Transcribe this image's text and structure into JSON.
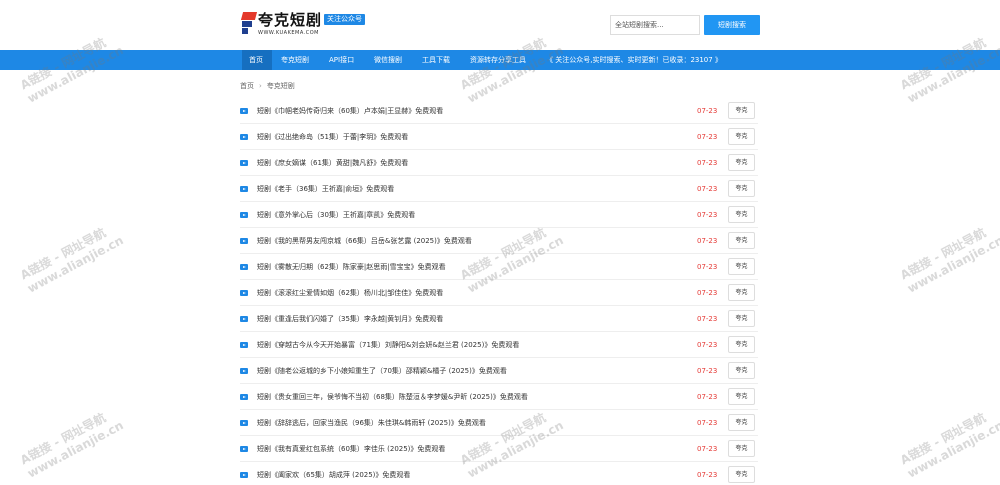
{
  "header": {
    "logo_title": "夸克短剧",
    "logo_sub": "WWW.KUAKEMA.COM",
    "follow_badge": "关注公众号",
    "search_placeholder": "全站短剧搜索...",
    "search_button": "短剧搜索"
  },
  "nav": {
    "items": [
      "首页",
      "夸克短剧",
      "API接口",
      "微信搜剧",
      "工具下载",
      "资源转存分享工具",
      "《 关注公众号,实时搜索、实时更新！已收录：23107 》"
    ],
    "active_index": 0
  },
  "breadcrumb": {
    "home": "首页",
    "separator": "›",
    "current": "夸克短剧"
  },
  "list": {
    "items": [
      {
        "title": "短剧《巾帼老妈传奇归来（60集）卢本娟|王显赫》免费观看",
        "date": "07-23",
        "action": "夸克"
      },
      {
        "title": "短剧《过出绝命岛（51集）于蕾|李玥》免费观看",
        "date": "07-23",
        "action": "夸克"
      },
      {
        "title": "短剧《庶女嫡谋（61集）黄甜|魏凡舒》免费观看",
        "date": "07-23",
        "action": "夸克"
      },
      {
        "title": "短剧《老手（36集）王祈嘉|俞垣》免费观看",
        "date": "07-23",
        "action": "夸克"
      },
      {
        "title": "短剧《意外掌心后（30集）王祈嘉|章凯》免费观看",
        "date": "07-23",
        "action": "夸克"
      },
      {
        "title": "短剧《我的黑帮男友闯京城（66集）吕岳&张艺露 (2025)》免费观看",
        "date": "07-23",
        "action": "夸克"
      },
      {
        "title": "短剧《雾散无归期（62集）陈家豪|赵思雨|雪宝宝》免费观看",
        "date": "07-23",
        "action": "夸克"
      },
      {
        "title": "短剧《滚滚红尘爱情如烟（62集）杨川北|邹佳佳》免费观看",
        "date": "07-23",
        "action": "夸克"
      },
      {
        "title": "短剧《重逢后我们闪婚了（35集）李永越|黄钊月》免费观看",
        "date": "07-23",
        "action": "夸克"
      },
      {
        "title": "短剧《穿越古今从今天开始暴富（71集）刘静阳&刘会妍&赵兰君 (2025)》免费观看",
        "date": "07-23",
        "action": "夸克"
      },
      {
        "title": "短剧《随老公返城的乡下小娘知重生了（70集）邵精颖&橘子 (2025)》免费观看",
        "date": "07-23",
        "action": "夸克"
      },
      {
        "title": "短剧《贵女重回三年，侯爷悔不当初（68集）陈楚洹＆李梦媛&尹昕 (2025)》免费观看",
        "date": "07-23",
        "action": "夸克"
      },
      {
        "title": "短剧《辞辞逃后，回家当渔民（96集）朱佳琪&韩雨轩 (2025)》免费观看",
        "date": "07-23",
        "action": "夸克"
      },
      {
        "title": "短剧《我有真爱红包系统（60集）李佳乐 (2025)》免费观看",
        "date": "07-23",
        "action": "夸克"
      },
      {
        "title": "短剧《阖家欢（65集）胡成萍 (2025)》免费观看",
        "date": "07-23",
        "action": "夸克"
      }
    ]
  },
  "watermark": {
    "line1": "A链接 - 网址导航",
    "line2": "www.alianjie.cn"
  },
  "colors": {
    "accent": "#1e88e5",
    "date": "#e53935"
  }
}
